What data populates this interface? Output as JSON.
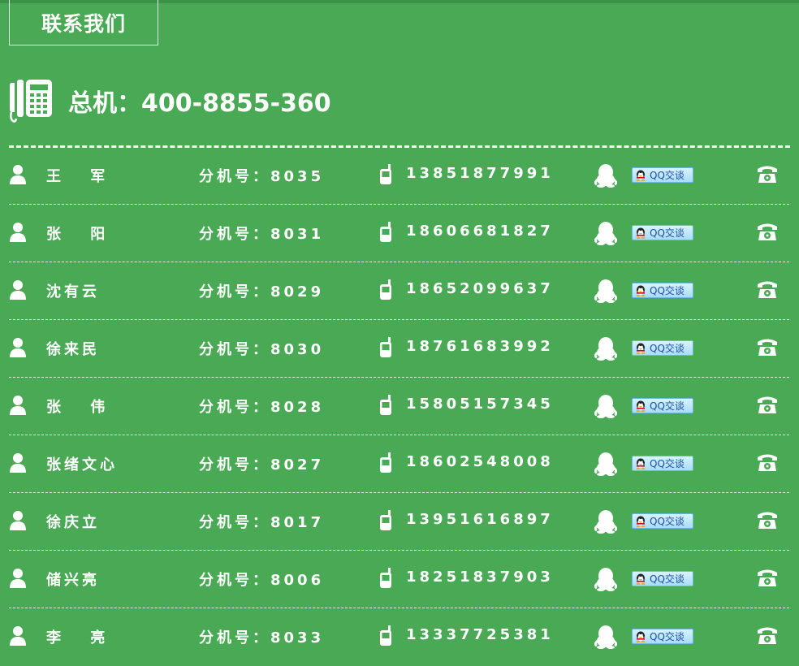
{
  "header": {
    "title": "联系我们"
  },
  "hotline": {
    "label": "总机：400-8855-360"
  },
  "contacts": [
    {
      "name": "王　 军",
      "ext": "分机号：8035",
      "mobile": "13851877991",
      "qq_label": "QQ交谈"
    },
    {
      "name": "张　 阳",
      "ext": "分机号：8031",
      "mobile": "18606681827",
      "qq_label": "QQ交谈"
    },
    {
      "name": "沈有云",
      "ext": "分机号：8029",
      "mobile": "18652099637",
      "qq_label": "QQ交谈"
    },
    {
      "name": "徐来民",
      "ext": "分机号：8030",
      "mobile": "18761683992",
      "qq_label": "QQ交谈"
    },
    {
      "name": "张　 伟",
      "ext": "分机号：8028",
      "mobile": "15805157345",
      "qq_label": "QQ交谈"
    },
    {
      "name": "张绪文心",
      "ext": "分机号：8027",
      "mobile": "18602548008",
      "qq_label": "QQ交谈"
    },
    {
      "name": "徐庆立",
      "ext": "分机号：8017",
      "mobile": "13951616897",
      "qq_label": "QQ交谈"
    },
    {
      "name": "储兴亮",
      "ext": "分机号：8006",
      "mobile": "18251837903",
      "qq_label": "QQ交谈"
    },
    {
      "name": "李　 亮",
      "ext": "分机号：8033",
      "mobile": "13337725381",
      "qq_label": "QQ交谈"
    }
  ],
  "icons": {
    "hotline": "desk-phone-icon",
    "person": "user-icon",
    "mobile": "mobile-phone-icon",
    "qq": "qq-penguin-icon",
    "phone": "telephone-icon"
  },
  "colors": {
    "background": "#49a954",
    "text": "#ffffff",
    "qq_button": "#a9dcf7"
  }
}
